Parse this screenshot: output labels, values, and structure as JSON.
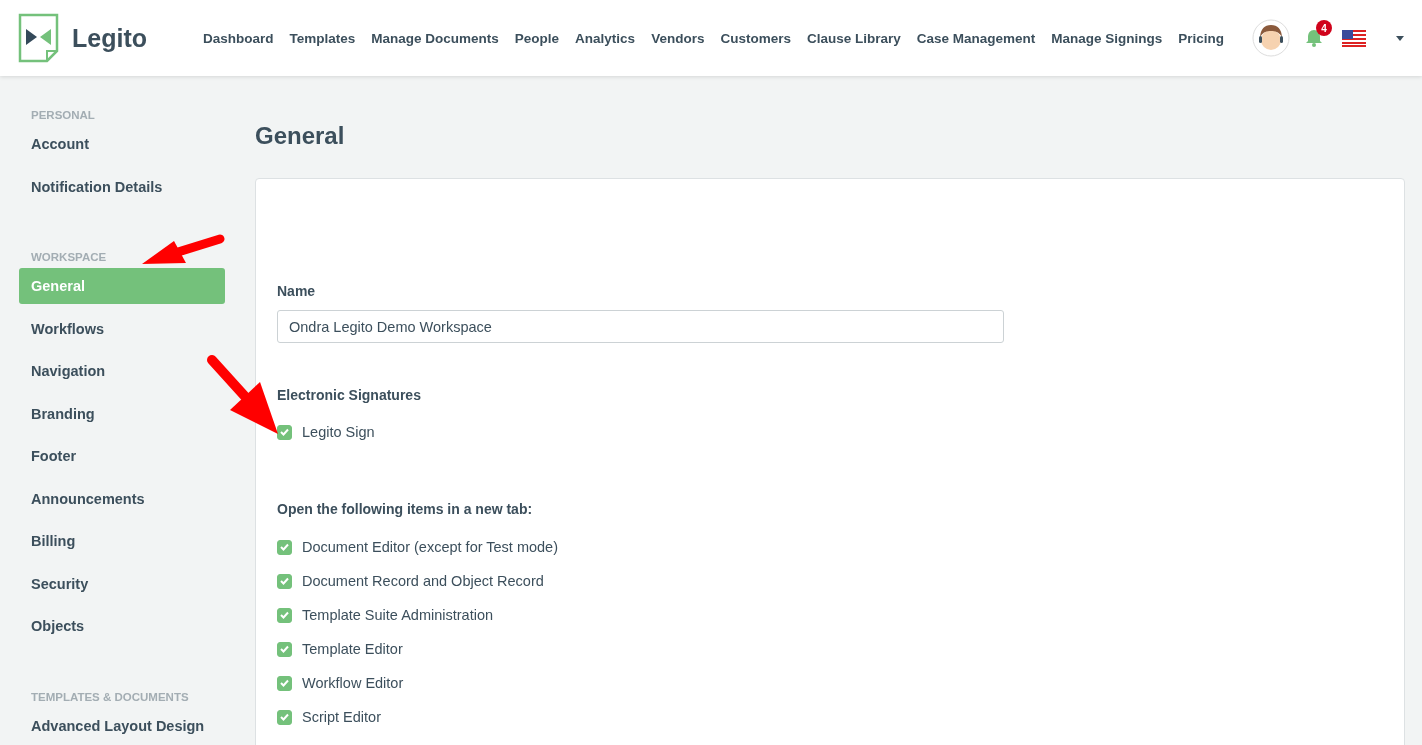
{
  "header": {
    "logo_text": "Legito",
    "nav": [
      {
        "label": "Dashboard"
      },
      {
        "label": "Templates"
      },
      {
        "label": "Manage Documents"
      },
      {
        "label": "People"
      },
      {
        "label": "Analytics"
      },
      {
        "label": "Vendors"
      },
      {
        "label": "Customers"
      },
      {
        "label": "Clause Library"
      },
      {
        "label": "Case Management"
      },
      {
        "label": "Manage Signings"
      },
      {
        "label": "Pricing"
      }
    ],
    "notification_count": "4"
  },
  "sidebar": {
    "sections": [
      {
        "heading": "PERSONAL",
        "items": [
          {
            "label": "Account",
            "selected": false
          },
          {
            "label": "Notification Details",
            "selected": false
          }
        ]
      },
      {
        "heading": "WORKSPACE",
        "items": [
          {
            "label": "General",
            "selected": true
          },
          {
            "label": "Workflows",
            "selected": false
          },
          {
            "label": "Navigation",
            "selected": false
          },
          {
            "label": "Branding",
            "selected": false
          },
          {
            "label": "Footer",
            "selected": false
          },
          {
            "label": "Announcements",
            "selected": false
          },
          {
            "label": "Billing",
            "selected": false
          },
          {
            "label": "Security",
            "selected": false
          },
          {
            "label": "Objects",
            "selected": false
          }
        ]
      },
      {
        "heading": "TEMPLATES & DOCUMENTS",
        "items": [
          {
            "label": "Advanced Layout Design",
            "selected": false
          }
        ]
      }
    ]
  },
  "main": {
    "title": "General",
    "name_field": {
      "label": "Name",
      "value": "Ondra Legito Demo Workspace"
    },
    "signatures": {
      "label": "Electronic Signatures",
      "options": [
        {
          "label": "Legito Sign",
          "checked": true
        }
      ]
    },
    "new_tab": {
      "label": "Open the following items in a new tab:",
      "options": [
        {
          "label": "Document Editor (except for Test mode)",
          "checked": true
        },
        {
          "label": "Document Record and Object Record",
          "checked": true
        },
        {
          "label": "Template Suite Administration",
          "checked": true
        },
        {
          "label": "Template Editor",
          "checked": true
        },
        {
          "label": "Workflow Editor",
          "checked": true
        },
        {
          "label": "Script Editor",
          "checked": true
        }
      ]
    }
  }
}
